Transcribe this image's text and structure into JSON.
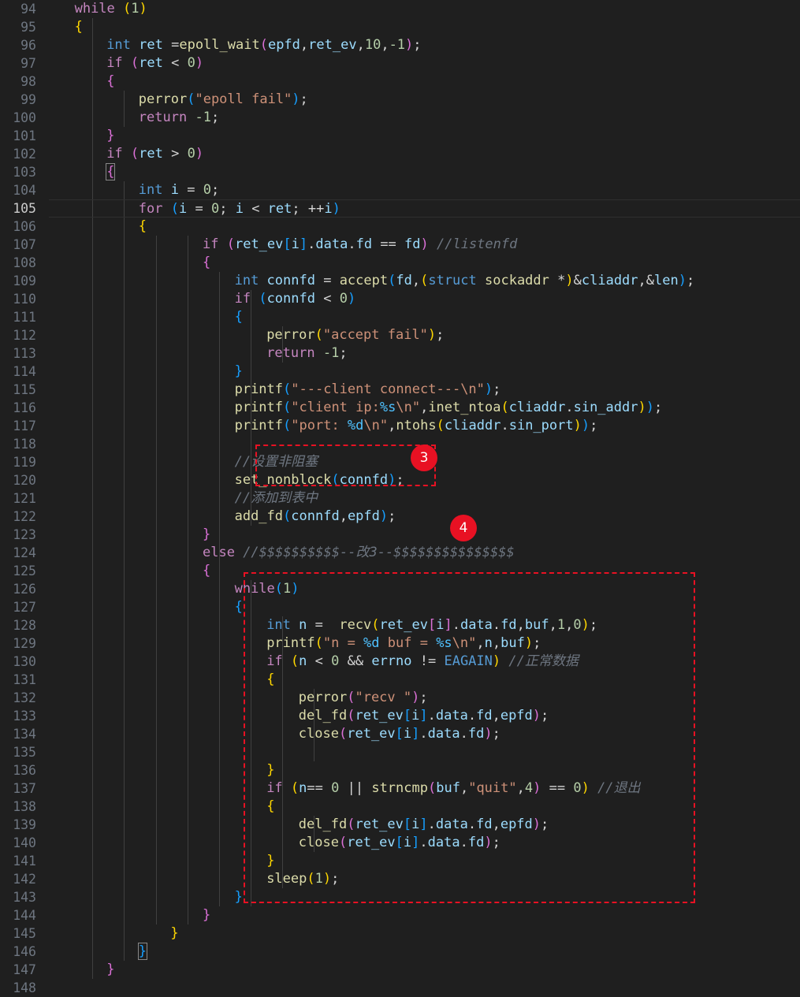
{
  "line_numbers": [
    "94",
    "95",
    "96",
    "97",
    "98",
    "99",
    "100",
    "101",
    "102",
    "103",
    "104",
    "105",
    "106",
    "107",
    "108",
    "109",
    "110",
    "111",
    "112",
    "113",
    "114",
    "115",
    "116",
    "117",
    "118",
    "119",
    "120",
    "121",
    "122",
    "123",
    "124",
    "125",
    "126",
    "127",
    "128",
    "129",
    "130",
    "131",
    "132",
    "133",
    "134",
    "135",
    "136",
    "137",
    "138",
    "139",
    "140",
    "141",
    "142",
    "143",
    "144",
    "145",
    "146",
    "147",
    "148"
  ],
  "active_line": "105",
  "code_lines": [
    [
      [
        "ctl",
        "while "
      ],
      [
        "p1",
        "("
      ],
      [
        "num",
        "1"
      ],
      [
        "p1",
        ")"
      ]
    ],
    [
      [
        "p1",
        "{"
      ]
    ],
    [
      [
        "kw",
        "int "
      ],
      [
        "var",
        "ret "
      ],
      [
        "op",
        "="
      ],
      [
        "fn",
        "epoll_wait"
      ],
      [
        "p2",
        "("
      ],
      [
        "var",
        "epfd"
      ],
      [
        "op",
        ","
      ],
      [
        "var",
        "ret_ev"
      ],
      [
        "op",
        ","
      ],
      [
        "num",
        "10"
      ],
      [
        "op",
        ","
      ],
      [
        "num",
        "-1"
      ],
      [
        "p2",
        ")"
      ],
      [
        "op",
        ";"
      ]
    ],
    [
      [
        "ctl",
        "if "
      ],
      [
        "p2",
        "("
      ],
      [
        "var",
        "ret "
      ],
      [
        "op",
        "< "
      ],
      [
        "num",
        "0"
      ],
      [
        "p2",
        ")"
      ]
    ],
    [
      [
        "p2",
        "{"
      ]
    ],
    [
      [
        "fn",
        "perror"
      ],
      [
        "p3",
        "("
      ],
      [
        "str",
        "\"epoll fail\""
      ],
      [
        "p3",
        ")"
      ],
      [
        "op",
        ";"
      ]
    ],
    [
      [
        "ctl",
        "return "
      ],
      [
        "num",
        "-1"
      ],
      [
        "op",
        ";"
      ]
    ],
    [
      [
        "p2",
        "}"
      ]
    ],
    [
      [
        "ctl",
        "if "
      ],
      [
        "p2",
        "("
      ],
      [
        "var",
        "ret "
      ],
      [
        "op",
        "> "
      ],
      [
        "num",
        "0"
      ],
      [
        "p2",
        ")"
      ]
    ],
    [
      [
        "p2",
        "{"
      ]
    ],
    [
      [
        "kw",
        "int "
      ],
      [
        "var",
        "i "
      ],
      [
        "op",
        "= "
      ],
      [
        "num",
        "0"
      ],
      [
        "op",
        ";"
      ]
    ],
    [
      [
        "ctl",
        "for "
      ],
      [
        "p3",
        "("
      ],
      [
        "var",
        "i "
      ],
      [
        "op",
        "= "
      ],
      [
        "num",
        "0"
      ],
      [
        "op",
        "; "
      ],
      [
        "var",
        "i "
      ],
      [
        "op",
        "< "
      ],
      [
        "var",
        "ret"
      ],
      [
        "op",
        "; "
      ],
      [
        "op",
        "++"
      ],
      [
        "var",
        "i"
      ],
      [
        "p3",
        ")"
      ]
    ],
    [
      [
        "p1",
        "{"
      ]
    ],
    [
      [
        "ctl",
        "if "
      ],
      [
        "p2",
        "("
      ],
      [
        "var",
        "ret_ev"
      ],
      [
        "p3",
        "["
      ],
      [
        "var",
        "i"
      ],
      [
        "p3",
        "]"
      ],
      [
        "op",
        "."
      ],
      [
        "var",
        "data"
      ],
      [
        "op",
        "."
      ],
      [
        "var",
        "fd "
      ],
      [
        "op",
        "== "
      ],
      [
        "var",
        "fd"
      ],
      [
        "p2",
        ")"
      ],
      [
        "cmg",
        " //listenfd"
      ]
    ],
    [
      [
        "p2",
        "{"
      ]
    ],
    [
      [
        "kw",
        "int "
      ],
      [
        "var",
        "connfd "
      ],
      [
        "op",
        "= "
      ],
      [
        "fn",
        "accept"
      ],
      [
        "p3",
        "("
      ],
      [
        "var",
        "fd"
      ],
      [
        "op",
        ","
      ],
      [
        "p1",
        "("
      ],
      [
        "kw",
        "struct "
      ],
      [
        "fn",
        "sockaddr "
      ],
      [
        "op",
        "*"
      ],
      [
        "p1",
        ")"
      ],
      [
        "op",
        "&"
      ],
      [
        "var",
        "cliaddr"
      ],
      [
        "op",
        ",&"
      ],
      [
        "var",
        "len"
      ],
      [
        "p3",
        ")"
      ],
      [
        "op",
        ";"
      ]
    ],
    [
      [
        "ctl",
        "if "
      ],
      [
        "p3",
        "("
      ],
      [
        "var",
        "connfd "
      ],
      [
        "op",
        "< "
      ],
      [
        "num",
        "0"
      ],
      [
        "p3",
        ")"
      ]
    ],
    [
      [
        "p3",
        "{"
      ]
    ],
    [
      [
        "fn",
        "perror"
      ],
      [
        "p1",
        "("
      ],
      [
        "str",
        "\"accept fail\""
      ],
      [
        "p1",
        ")"
      ],
      [
        "op",
        ";"
      ]
    ],
    [
      [
        "ctl",
        "return "
      ],
      [
        "num",
        "-1"
      ],
      [
        "op",
        ";"
      ]
    ],
    [
      [
        "p3",
        "}"
      ]
    ],
    [
      [
        "fn",
        "printf"
      ],
      [
        "p3",
        "("
      ],
      [
        "str",
        "\"---client connect---\\n\""
      ],
      [
        "p3",
        ")"
      ],
      [
        "op",
        ";"
      ]
    ],
    [
      [
        "fn",
        "printf"
      ],
      [
        "p3",
        "("
      ],
      [
        "str",
        "\"client ip:"
      ],
      [
        "fnb",
        "%s"
      ],
      [
        "str",
        "\\n\""
      ],
      [
        "op",
        ","
      ],
      [
        "fn",
        "inet_ntoa"
      ],
      [
        "p1",
        "("
      ],
      [
        "var",
        "cliaddr"
      ],
      [
        "op",
        "."
      ],
      [
        "var",
        "sin_addr"
      ],
      [
        "p1",
        ")"
      ],
      [
        "p3",
        ")"
      ],
      [
        "op",
        ";"
      ]
    ],
    [
      [
        "fn",
        "printf"
      ],
      [
        "p3",
        "("
      ],
      [
        "str",
        "\"port: "
      ],
      [
        "fnb",
        "%d"
      ],
      [
        "str",
        "\\n\""
      ],
      [
        "op",
        ","
      ],
      [
        "fn",
        "ntohs"
      ],
      [
        "p1",
        "("
      ],
      [
        "var",
        "cliaddr"
      ],
      [
        "op",
        "."
      ],
      [
        "var",
        "sin_port"
      ],
      [
        "p1",
        ")"
      ],
      [
        "p3",
        ")"
      ],
      [
        "op",
        ";"
      ]
    ],
    [],
    [
      [
        "cmg",
        "//设置非阻塞"
      ]
    ],
    [
      [
        "fn",
        "set_nonblock"
      ],
      [
        "p3",
        "("
      ],
      [
        "var",
        "connfd"
      ],
      [
        "p3",
        ")"
      ],
      [
        "op",
        ";"
      ]
    ],
    [
      [
        "cmg",
        "//添加到表中"
      ]
    ],
    [
      [
        "fn",
        "add_fd"
      ],
      [
        "p3",
        "("
      ],
      [
        "var",
        "connfd"
      ],
      [
        "op",
        ","
      ],
      [
        "var",
        "epfd"
      ],
      [
        "p3",
        ")"
      ],
      [
        "op",
        ";"
      ]
    ],
    [
      [
        "p2",
        "}"
      ]
    ],
    [
      [
        "ctl",
        "else "
      ],
      [
        "cmg",
        "//$$$$$$$$$$--改3--$$$$$$$$$$$$$$$"
      ]
    ],
    [
      [
        "p2",
        "{"
      ]
    ],
    [
      [
        "ctl",
        "while"
      ],
      [
        "p3",
        "("
      ],
      [
        "num",
        "1"
      ],
      [
        "p3",
        ")"
      ]
    ],
    [
      [
        "p3",
        "{"
      ]
    ],
    [
      [
        "kw",
        "int "
      ],
      [
        "var",
        "n "
      ],
      [
        "op",
        "=  "
      ],
      [
        "fn",
        "recv"
      ],
      [
        "p1",
        "("
      ],
      [
        "var",
        "ret_ev"
      ],
      [
        "p2",
        "["
      ],
      [
        "var",
        "i"
      ],
      [
        "p2",
        "]"
      ],
      [
        "op",
        "."
      ],
      [
        "var",
        "data"
      ],
      [
        "op",
        "."
      ],
      [
        "var",
        "fd"
      ],
      [
        "op",
        ","
      ],
      [
        "var",
        "buf"
      ],
      [
        "op",
        ","
      ],
      [
        "num",
        "1"
      ],
      [
        "op",
        ","
      ],
      [
        "num",
        "0"
      ],
      [
        "p1",
        ")"
      ],
      [
        "op",
        ";"
      ]
    ],
    [
      [
        "fn",
        "printf"
      ],
      [
        "p1",
        "("
      ],
      [
        "str",
        "\"n = "
      ],
      [
        "fnb",
        "%d"
      ],
      [
        "str",
        " buf = "
      ],
      [
        "fnb",
        "%s"
      ],
      [
        "str",
        "\\n\""
      ],
      [
        "op",
        ","
      ],
      [
        "var",
        "n"
      ],
      [
        "op",
        ","
      ],
      [
        "var",
        "buf"
      ],
      [
        "p1",
        ")"
      ],
      [
        "op",
        ";"
      ]
    ],
    [
      [
        "ctl",
        "if "
      ],
      [
        "p1",
        "("
      ],
      [
        "var",
        "n "
      ],
      [
        "op",
        "< "
      ],
      [
        "num",
        "0 "
      ],
      [
        "op",
        "&& "
      ],
      [
        "var",
        "errno "
      ],
      [
        "op",
        "!= "
      ],
      [
        "kw",
        "EAGAIN"
      ],
      [
        "p1",
        ")"
      ],
      [
        "cmg",
        " //正常数据"
      ]
    ],
    [
      [
        "p1",
        "{"
      ]
    ],
    [
      [
        "fn",
        "perror"
      ],
      [
        "p2",
        "("
      ],
      [
        "str",
        "\"recv \""
      ],
      [
        "p2",
        ")"
      ],
      [
        "op",
        ";"
      ]
    ],
    [
      [
        "fn",
        "del_fd"
      ],
      [
        "p2",
        "("
      ],
      [
        "var",
        "ret_ev"
      ],
      [
        "p3",
        "["
      ],
      [
        "var",
        "i"
      ],
      [
        "p3",
        "]"
      ],
      [
        "op",
        "."
      ],
      [
        "var",
        "data"
      ],
      [
        "op",
        "."
      ],
      [
        "var",
        "fd"
      ],
      [
        "op",
        ","
      ],
      [
        "var",
        "epfd"
      ],
      [
        "p2",
        ")"
      ],
      [
        "op",
        ";"
      ]
    ],
    [
      [
        "fn",
        "close"
      ],
      [
        "p2",
        "("
      ],
      [
        "var",
        "ret_ev"
      ],
      [
        "p3",
        "["
      ],
      [
        "var",
        "i"
      ],
      [
        "p3",
        "]"
      ],
      [
        "op",
        "."
      ],
      [
        "var",
        "data"
      ],
      [
        "op",
        "."
      ],
      [
        "var",
        "fd"
      ],
      [
        "p2",
        ")"
      ],
      [
        "op",
        ";"
      ]
    ],
    [],
    [
      [
        "p1",
        "}"
      ]
    ],
    [
      [
        "ctl",
        "if "
      ],
      [
        "p1",
        "("
      ],
      [
        "var",
        "n"
      ],
      [
        "op",
        "== "
      ],
      [
        "num",
        "0 "
      ],
      [
        "op",
        "|| "
      ],
      [
        "fn",
        "strncmp"
      ],
      [
        "p2",
        "("
      ],
      [
        "var",
        "buf"
      ],
      [
        "op",
        ","
      ],
      [
        "str",
        "\"quit\""
      ],
      [
        "op",
        ","
      ],
      [
        "num",
        "4"
      ],
      [
        "p2",
        ")"
      ],
      [
        "op",
        " == "
      ],
      [
        "num",
        "0"
      ],
      [
        "p1",
        ")"
      ],
      [
        "cmg",
        " //退出"
      ]
    ],
    [
      [
        "p1",
        "{"
      ]
    ],
    [
      [
        "fn",
        "del_fd"
      ],
      [
        "p2",
        "("
      ],
      [
        "var",
        "ret_ev"
      ],
      [
        "p3",
        "["
      ],
      [
        "var",
        "i"
      ],
      [
        "p3",
        "]"
      ],
      [
        "op",
        "."
      ],
      [
        "var",
        "data"
      ],
      [
        "op",
        "."
      ],
      [
        "var",
        "fd"
      ],
      [
        "op",
        ","
      ],
      [
        "var",
        "epfd"
      ],
      [
        "p2",
        ")"
      ],
      [
        "op",
        ";"
      ]
    ],
    [
      [
        "fn",
        "close"
      ],
      [
        "p2",
        "("
      ],
      [
        "var",
        "ret_ev"
      ],
      [
        "p3",
        "["
      ],
      [
        "var",
        "i"
      ],
      [
        "p3",
        "]"
      ],
      [
        "op",
        "."
      ],
      [
        "var",
        "data"
      ],
      [
        "op",
        "."
      ],
      [
        "var",
        "fd"
      ],
      [
        "p2",
        ")"
      ],
      [
        "op",
        ";"
      ]
    ],
    [
      [
        "p1",
        "}"
      ]
    ],
    [
      [
        "fn",
        "sleep"
      ],
      [
        "p1",
        "("
      ],
      [
        "num",
        "1"
      ],
      [
        "p1",
        ")"
      ],
      [
        "op",
        ";"
      ]
    ],
    [
      [
        "p3",
        "}"
      ]
    ],
    [
      [
        "p2",
        "}"
      ]
    ],
    [
      [
        "p1",
        "}"
      ]
    ],
    [
      [
        "p3",
        "}"
      ]
    ],
    [
      [
        "p2",
        "}"
      ]
    ],
    []
  ],
  "annotations": [
    {
      "label": "3",
      "color": "#e81123"
    },
    {
      "label": "4",
      "color": "#e81123"
    }
  ]
}
